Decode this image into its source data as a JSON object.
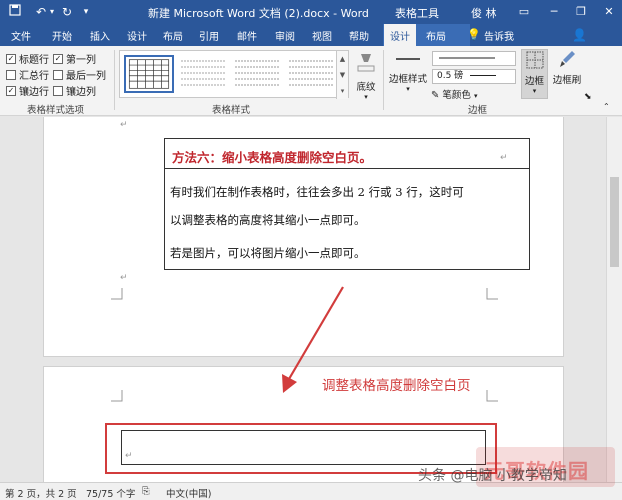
{
  "titlebar": {
    "title": "新建 Microsoft Word 文档 (2).docx  -  Word",
    "context_label": "表格工具",
    "user": "俊 林",
    "icons": [
      "save-icon",
      "undo-icon",
      "redo-icon",
      "customize-icon"
    ]
  },
  "tabs": [
    "文件",
    "开始",
    "插入",
    "设计",
    "布局",
    "引用",
    "邮件",
    "审阅",
    "视图",
    "帮助",
    "设计",
    "布局",
    "告诉我"
  ],
  "active_tab_index": 10,
  "ribbon": {
    "options": {
      "header_row": "标题行",
      "first_column": "第一列",
      "total_row": "汇总行",
      "last_column": "最后一列",
      "banded_rows": "镶边行",
      "banded_columns": "镶边列",
      "group_label": "表格样式选项"
    },
    "styles_group_label": "表格样式",
    "shading_label": "底纹",
    "border_styles_label": "边框样式",
    "pen_weight": "0.5 磅",
    "pen_color_label": "笔颜色",
    "borders_label": "边框",
    "border_painter_label": "边框刷",
    "borders_group_label": "边框"
  },
  "document": {
    "heading": "方法六：缩小表格高度删除空白页。",
    "para1_line1": "有时我们在制作表格时，往往会多出 2 行或 3 行，这时可",
    "para1_line2": "以调整表格的高度将其缩小一点即可。",
    "para2": "若是图片，可以将图片缩小一点即可。",
    "annotation": "调整表格高度删除空白页",
    "mark": "↵"
  },
  "status": {
    "page": "第 2 页，共 2 页",
    "words": "75/75 个字",
    "language": "中文(中国)"
  },
  "watermarks": {
    "source": "头条 @电脑 小教学帝知",
    "site": "元哥软件园"
  },
  "colors": {
    "title_bar": "#2b579a",
    "heading_red": "#c0262d",
    "annotation_red": "#d03a3a"
  }
}
